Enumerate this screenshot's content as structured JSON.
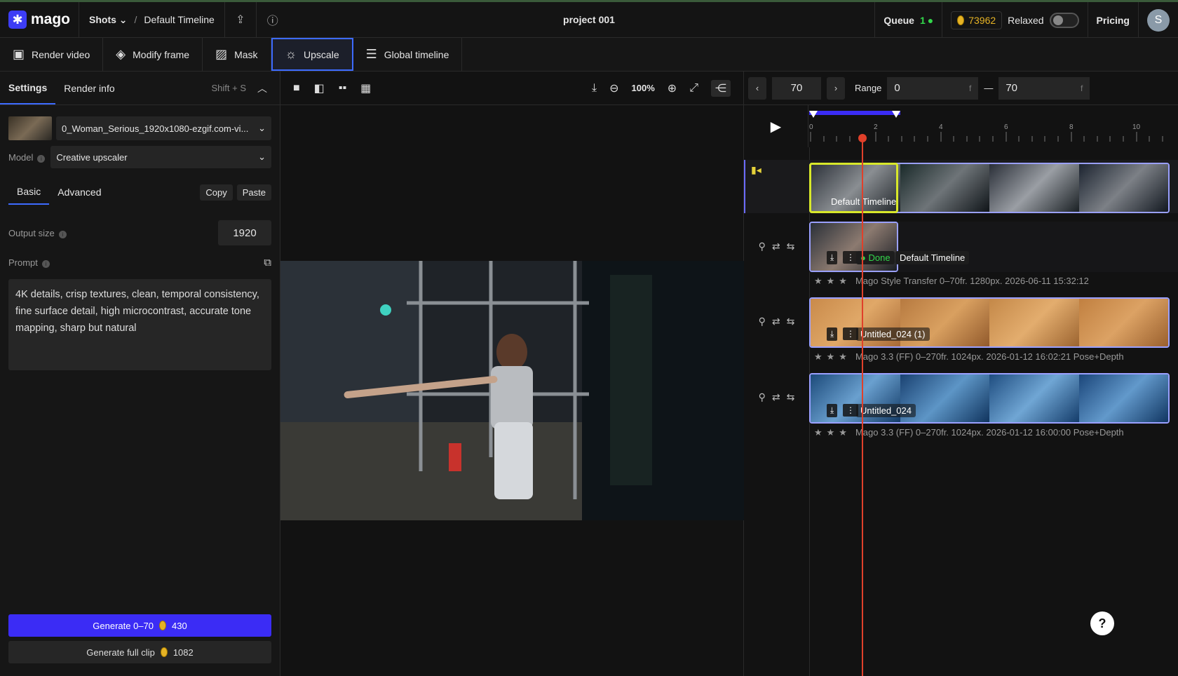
{
  "header": {
    "logo": "mago",
    "shots": "Shots",
    "breadcrumb_sep": "/",
    "timeline": "Default Timeline",
    "project": "project 001",
    "queue_label": "Queue",
    "queue_count": "1",
    "credits": "73962",
    "mode": "Relaxed",
    "pricing": "Pricing",
    "avatar": "S"
  },
  "toolbar": [
    {
      "label": "Render video",
      "icon": "camera-icon"
    },
    {
      "label": "Modify frame",
      "icon": "paint-bucket-icon"
    },
    {
      "label": "Mask",
      "icon": "mask-icon"
    },
    {
      "label": "Upscale",
      "icon": "upscale-icon"
    },
    {
      "label": "Global timeline",
      "icon": "timeline-icon"
    }
  ],
  "left": {
    "tab_settings": "Settings",
    "tab_render": "Render info",
    "shortcut": "Shift + S",
    "file": "0_Woman_Serious_1920x1080-ezgif.com-vi...",
    "model_label": "Model",
    "model": "Creative upscaler",
    "tab_basic": "Basic",
    "tab_advanced": "Advanced",
    "copy": "Copy",
    "paste": "Paste",
    "output_label": "Output size",
    "output_value": "1920",
    "prompt_label": "Prompt",
    "prompt": "4K details, crisp textures, clean, temporal consistency, fine surface detail, high microcontrast, accurate tone mapping, sharp but natural",
    "generate_label": "Generate 0–70",
    "generate_cost": "430",
    "full_label": "Generate full clip",
    "full_cost": "1082"
  },
  "center": {
    "zoom": "100%"
  },
  "timeline": {
    "frame": "70",
    "range_label": "Range",
    "range_start": "0",
    "range_end": "70",
    "unit": "f",
    "ticks": [
      "0",
      "2",
      "4",
      "6",
      "8",
      "10"
    ],
    "tracks": [
      {
        "name": "Default Timeline"
      },
      {
        "status": "Done",
        "name": "Default Timeline",
        "meta": "Mago Style Transfer   0–70fr.   1280px.   2026-06-11  15:32:12"
      },
      {
        "name": "Untitled_024 (1)",
        "meta": "Mago 3.3 (FF)   0–270fr.   1024px.   2026-01-12  16:02:21   Pose+Depth"
      },
      {
        "name": "Untitled_024",
        "meta": "Mago 3.3 (FF)   0–270fr.   1024px.   2026-01-12  16:00:00   Pose+Depth"
      }
    ]
  },
  "colors": {
    "accent": "#3d6bff",
    "generate": "#3b2cf5",
    "done": "#32d74b",
    "playhead": "#e0402a",
    "selected": "#d8e82a"
  }
}
